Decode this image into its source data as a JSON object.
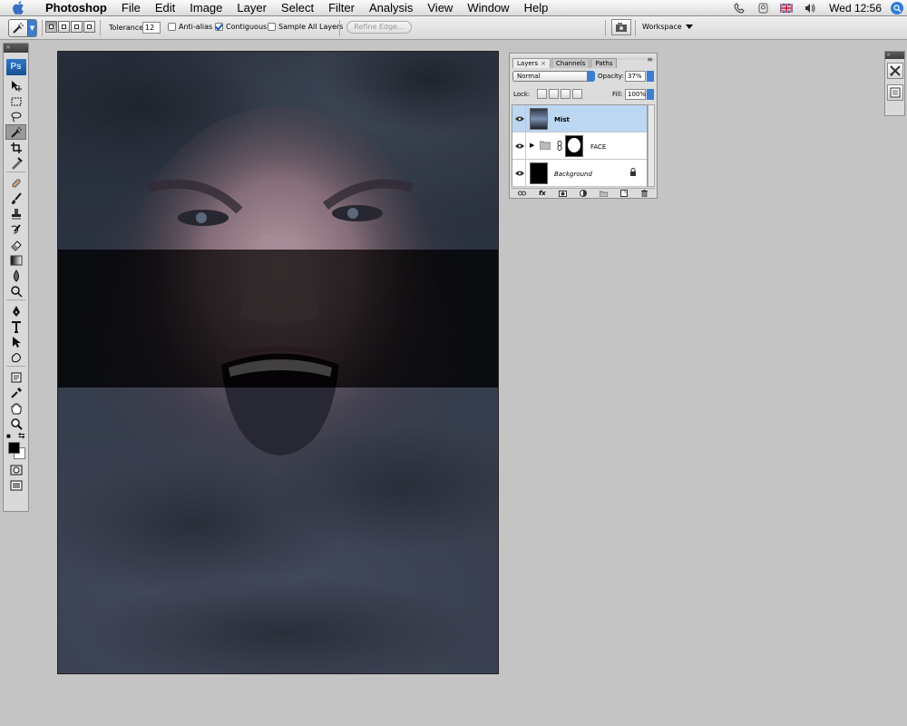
{
  "menubar": {
    "app_name": "Photoshop",
    "items": [
      "File",
      "Edit",
      "Image",
      "Layer",
      "Select",
      "Filter",
      "Analysis",
      "View",
      "Window",
      "Help"
    ],
    "clock": "Wed 12:56"
  },
  "options_bar": {
    "tolerance_label": "Tolerance:",
    "tolerance_value": "12",
    "anti_alias_label": "Anti-alias",
    "anti_alias_checked": false,
    "contiguous_label": "Contiguous",
    "contiguous_checked": true,
    "sample_all_label": "Sample All Layers",
    "sample_all_checked": false,
    "refine_edge_label": "Refine Edge...",
    "workspace_label": "Workspace"
  },
  "tools_panel": {
    "logo": "Ps",
    "active_tool": "magic-wand-tool",
    "foreground_color": "#000000",
    "background_color": "#ffffff"
  },
  "layers_panel": {
    "tabs": [
      "Layers",
      "Channels",
      "Paths"
    ],
    "active_tab": "Layers",
    "blend_mode": "Normal",
    "opacity_label": "Opacity:",
    "opacity_value": "37%",
    "lock_label": "Lock:",
    "fill_label": "Fill:",
    "fill_value": "100%",
    "layers": [
      {
        "name": "Mist",
        "selected": true,
        "visible": true
      },
      {
        "name": "FACE",
        "selected": false,
        "visible": true,
        "group": true
      },
      {
        "name": "Background",
        "selected": false,
        "visible": true,
        "locked": true
      }
    ]
  },
  "colors": {
    "selection_blue": "#bcd7f2",
    "accent_blue": "#3b7fd0"
  }
}
